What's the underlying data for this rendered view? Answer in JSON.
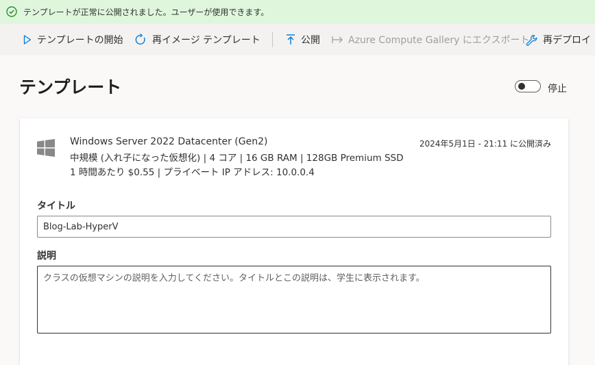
{
  "banner": {
    "message": "テンプレートが正常に公開されました。ユーザーが使用できます。",
    "icon": "success-check-icon",
    "color": "#dff6dd"
  },
  "toolbar": {
    "start_template": "テンプレートの開始",
    "reimage_template": "再イメージ テンプレート",
    "publish": "公開",
    "export_gallery": "Azure Compute Gallery にエクスポート",
    "redeploy": "再デプロイ"
  },
  "page": {
    "title": "テンプレート",
    "toggle_label": "停止",
    "toggle_on": false
  },
  "card": {
    "os_name": "Windows Server 2022 Datacenter (Gen2)",
    "spec_line1": "中規模 (入れ子になった仮想化) | 4 コア | 16 GB RAM | 128GB Premium SSD",
    "spec_line2": "1 時間あたり $0.55 | プライベート IP アドレス: 10.0.0.4",
    "published_text": "2024年5月1日 - 21:11 に公開済み",
    "title_label": "タイトル",
    "title_value": "Blog-Lab-HyperV",
    "description_label": "説明",
    "description_placeholder": "クラスの仮想マシンの説明を入力してください。タイトルとこの説明は、学生に表示されます。",
    "description_value": ""
  },
  "colors": {
    "accent": "#0078d4",
    "success": "#107c10",
    "disabled": "#a19f9d"
  }
}
